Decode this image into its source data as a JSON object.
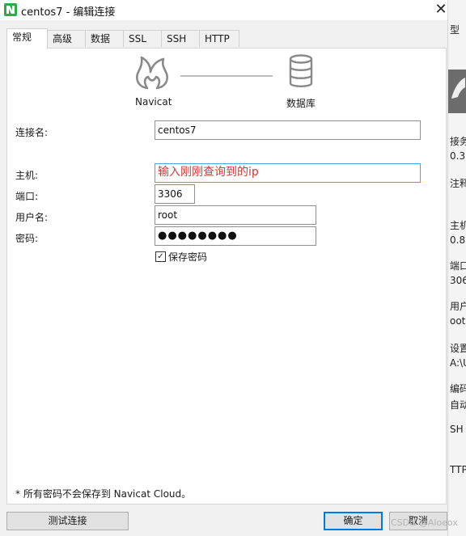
{
  "window": {
    "title": "centos7 - 编辑连接",
    "close_glyph": "✕"
  },
  "tabs": [
    {
      "label": "常规",
      "active": true
    },
    {
      "label": "高级",
      "active": false
    },
    {
      "label": "数据库",
      "active": false
    },
    {
      "label": "SSL",
      "active": false
    },
    {
      "label": "SSH",
      "active": false
    },
    {
      "label": "HTTP",
      "active": false
    }
  ],
  "diagram": {
    "left_label": "Navicat",
    "right_label": "数据库"
  },
  "form": {
    "connection_name_label": "连接名:",
    "connection_name_value": "centos7",
    "host_label": "主机:",
    "host_value": "输入刚刚查询到的ip",
    "port_label": "端口:",
    "port_value": "3306",
    "username_label": "用户名:",
    "username_value": "root",
    "password_label": "密码:",
    "password_value": "●●●●●●●●",
    "save_password_label": "保存密码",
    "save_password_checked": true,
    "save_password_check_glyph": "✓"
  },
  "footer_note": "* 所有密码不会保存到 Navicat Cloud。",
  "buttons": {
    "test": "测试连接",
    "ok": "确定",
    "cancel": "取消"
  },
  "background_window": {
    "top_fragment": "型",
    "fragments": [
      "接务",
      "0.3",
      "注释",
      "主机",
      "0.8",
      "端口",
      "306",
      "用户",
      "oot",
      "设置",
      "A:\\U",
      "编码",
      "自动",
      "SH",
      "TTP"
    ]
  },
  "watermark": "CSDN @Aloeox",
  "colors": {
    "accent": "#0078d7",
    "highlight_text": "#d43a3a",
    "highlight_border": "#46a7d6"
  }
}
